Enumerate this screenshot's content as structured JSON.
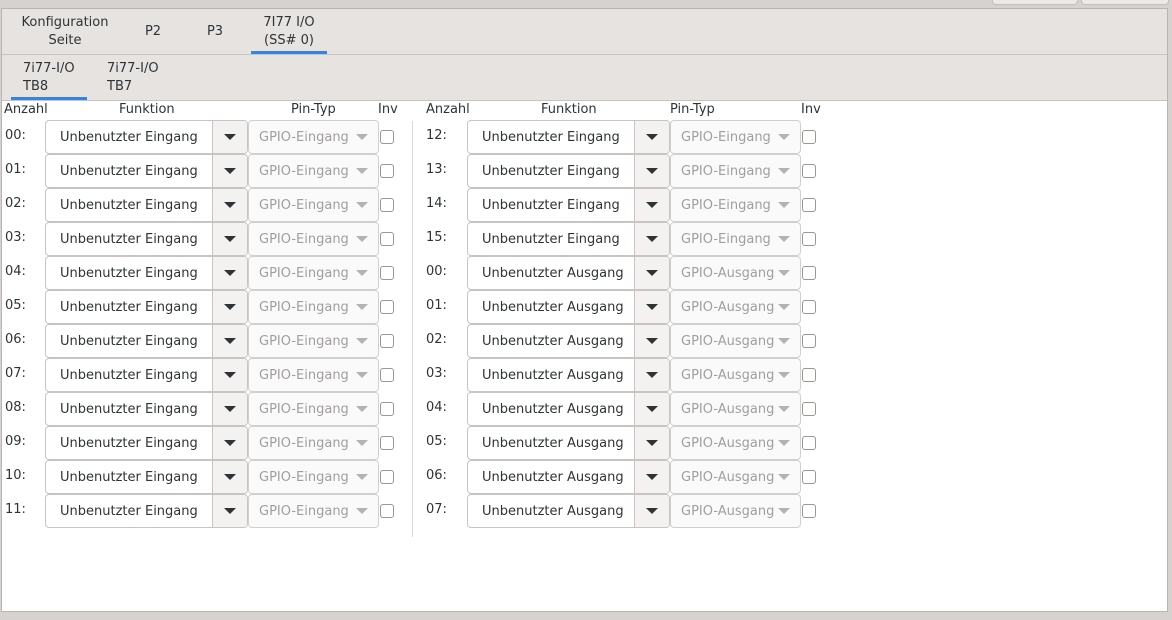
{
  "tabs_top": [
    {
      "label_line1": "Konfiguration",
      "label_line2": "Seite",
      "active": false
    },
    {
      "label_line1": "P2",
      "label_line2": "",
      "active": false
    },
    {
      "label_line1": "P3",
      "label_line2": "",
      "active": false
    },
    {
      "label_line1": "7I77 I/O",
      "label_line2": "(SS# 0)",
      "active": true
    }
  ],
  "tabs_sub": [
    {
      "label_line1": "7i77-I/O",
      "label_line2": "TB8",
      "active": true
    },
    {
      "label_line1": "7i77-I/O",
      "label_line2": "TB7",
      "active": false
    }
  ],
  "headers": {
    "count": "Anzahl",
    "function": "Funktion",
    "pin_type": "Pin-Typ",
    "inv": "Inv"
  },
  "left_rows": [
    {
      "pin": "00:",
      "function": "Unbenutzter Eingang",
      "pin_type": "GPIO-Eingang"
    },
    {
      "pin": "01:",
      "function": "Unbenutzter Eingang",
      "pin_type": "GPIO-Eingang"
    },
    {
      "pin": "02:",
      "function": "Unbenutzter Eingang",
      "pin_type": "GPIO-Eingang"
    },
    {
      "pin": "03:",
      "function": "Unbenutzter Eingang",
      "pin_type": "GPIO-Eingang"
    },
    {
      "pin": "04:",
      "function": "Unbenutzter Eingang",
      "pin_type": "GPIO-Eingang"
    },
    {
      "pin": "05:",
      "function": "Unbenutzter Eingang",
      "pin_type": "GPIO-Eingang"
    },
    {
      "pin": "06:",
      "function": "Unbenutzter Eingang",
      "pin_type": "GPIO-Eingang"
    },
    {
      "pin": "07:",
      "function": "Unbenutzter Eingang",
      "pin_type": "GPIO-Eingang"
    },
    {
      "pin": "08:",
      "function": "Unbenutzter Eingang",
      "pin_type": "GPIO-Eingang"
    },
    {
      "pin": "09:",
      "function": "Unbenutzter Eingang",
      "pin_type": "GPIO-Eingang"
    },
    {
      "pin": "10:",
      "function": "Unbenutzter Eingang",
      "pin_type": "GPIO-Eingang"
    },
    {
      "pin": "11:",
      "function": "Unbenutzter Eingang",
      "pin_type": "GPIO-Eingang"
    }
  ],
  "right_rows": [
    {
      "pin": "12:",
      "function": "Unbenutzter Eingang",
      "pin_type": "GPIO-Eingang"
    },
    {
      "pin": "13:",
      "function": "Unbenutzter Eingang",
      "pin_type": "GPIO-Eingang"
    },
    {
      "pin": "14:",
      "function": "Unbenutzter Eingang",
      "pin_type": "GPIO-Eingang"
    },
    {
      "pin": "15:",
      "function": "Unbenutzter Eingang",
      "pin_type": "GPIO-Eingang"
    },
    {
      "pin": "00:",
      "function": "Unbenutzter Ausgang",
      "pin_type": "GPIO-Ausgang"
    },
    {
      "pin": "01:",
      "function": "Unbenutzter Ausgang",
      "pin_type": "GPIO-Ausgang"
    },
    {
      "pin": "02:",
      "function": "Unbenutzter Ausgang",
      "pin_type": "GPIO-Ausgang"
    },
    {
      "pin": "03:",
      "function": "Unbenutzter Ausgang",
      "pin_type": "GPIO-Ausgang"
    },
    {
      "pin": "04:",
      "function": "Unbenutzter Ausgang",
      "pin_type": "GPIO-Ausgang"
    },
    {
      "pin": "05:",
      "function": "Unbenutzter Ausgang",
      "pin_type": "GPIO-Ausgang"
    },
    {
      "pin": "06:",
      "function": "Unbenutzter Ausgang",
      "pin_type": "GPIO-Ausgang"
    },
    {
      "pin": "07:",
      "function": "Unbenutzter Ausgang",
      "pin_type": "GPIO-Ausgang"
    }
  ],
  "colors": {
    "accent": "#3584e4",
    "tab_bg": "#e6e3e1",
    "content_bg": "#ffffff"
  }
}
